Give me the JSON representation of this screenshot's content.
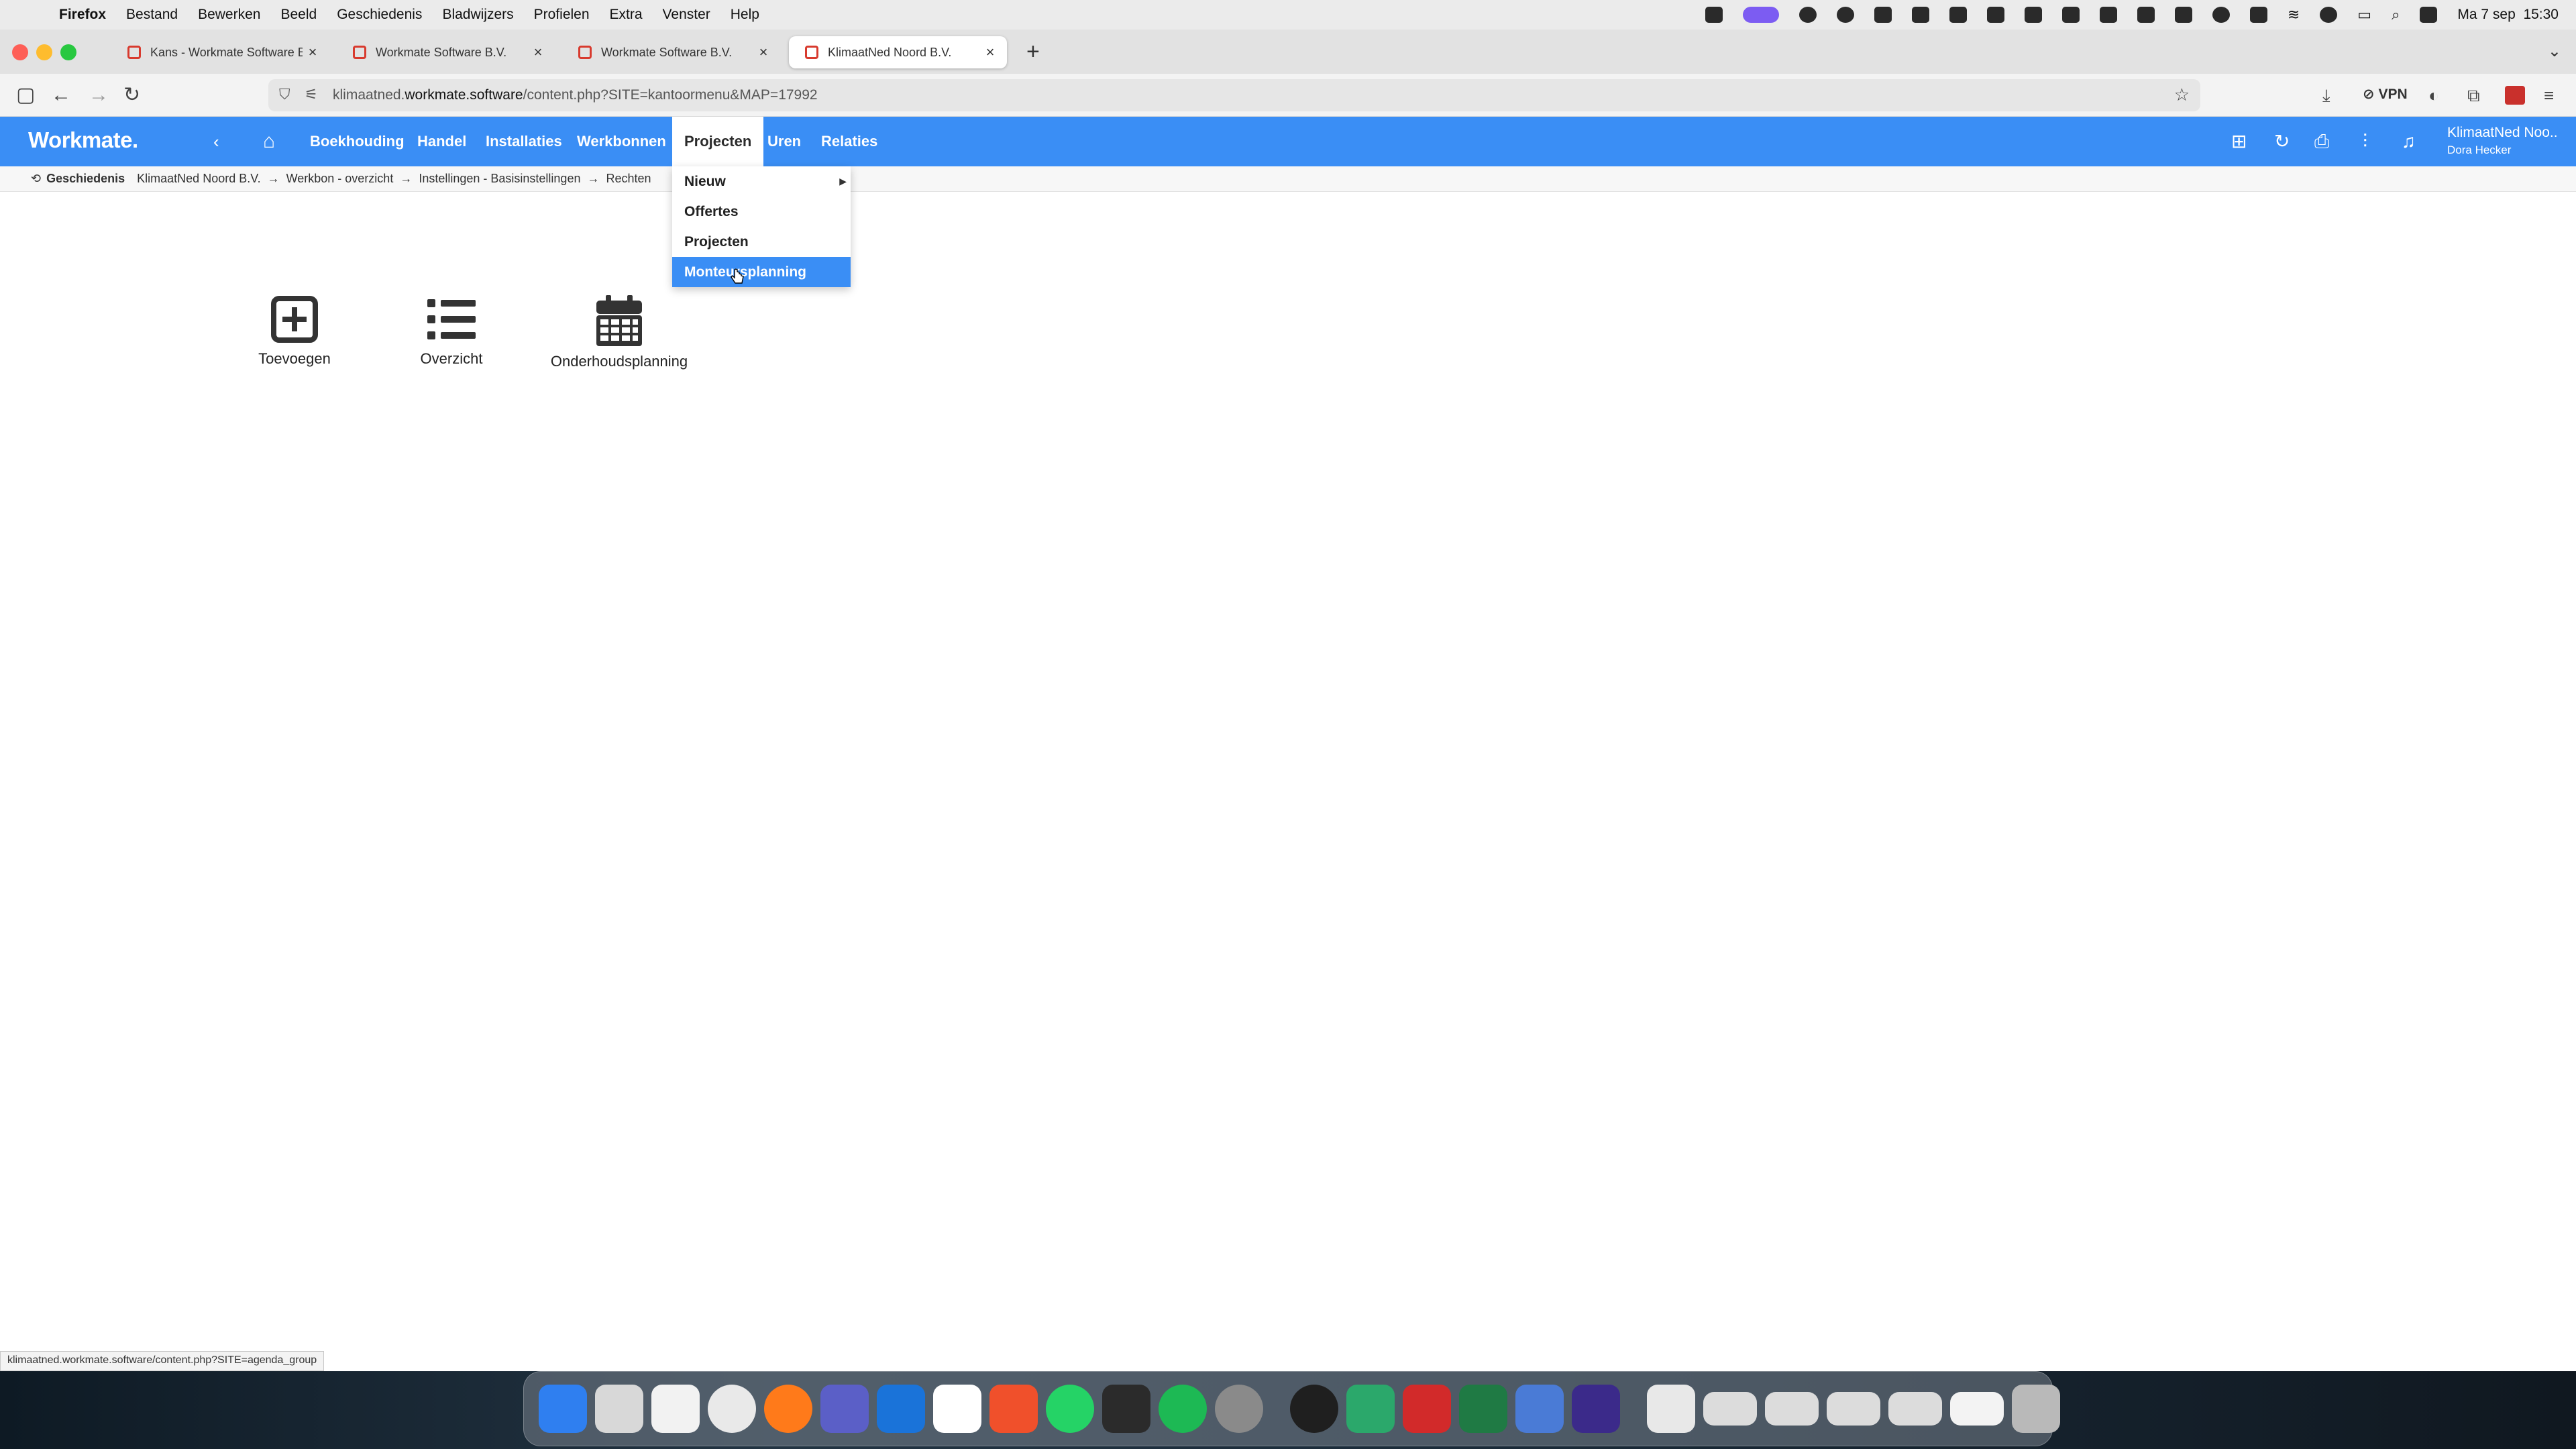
{
  "menubar": {
    "app": "Firefox",
    "items": [
      "Bestand",
      "Bewerken",
      "Beeld",
      "Geschiedenis",
      "Bladwijzers",
      "Profielen",
      "Extra",
      "Venster",
      "Help"
    ],
    "datetime": "Ma 7 sep  15:30"
  },
  "tabs": [
    {
      "label": "Kans - Workmate Software B.V."
    },
    {
      "label": "Workmate Software B.V."
    },
    {
      "label": "Workmate Software B.V."
    },
    {
      "label": "KlimaatNed Noord B.V."
    }
  ],
  "toolbar": {
    "url_prefix": "klimaatned.",
    "url_host": "workmate.software",
    "url_path": "/content.php?SITE=kantoormenu&MAP=17992",
    "vpn": "VPN"
  },
  "app": {
    "logo": "Workmate.",
    "nav": [
      "Boekhouding",
      "Handel",
      "Installaties",
      "Werkbonnen",
      "Projecten",
      "Uren",
      "Relaties"
    ],
    "active": "Projecten",
    "account_org": "KlimaatNed Noo..",
    "account_user": "Dora Hecker",
    "accent": "#3a8ef5"
  },
  "breadcrumb": {
    "history": "Geschiedenis",
    "items": [
      "KlimaatNed Noord B.V.",
      "Werkbon - overzicht",
      "Instellingen - Basisinstellingen",
      "Rechten"
    ]
  },
  "dropdown": {
    "items": [
      "Nieuw",
      "Offertes",
      "Projecten",
      "Monteursplanning"
    ],
    "highlighted": "Monteursplanning"
  },
  "tiles": [
    {
      "label": "Toevoegen",
      "icon": "plus-square-icon"
    },
    {
      "label": "Overzicht",
      "icon": "list-icon"
    },
    {
      "label": "Onderhoudsplanning",
      "icon": "calendar-icon"
    }
  ],
  "status_url": "klimaatned.workmate.software/content.php?SITE=agenda_group"
}
